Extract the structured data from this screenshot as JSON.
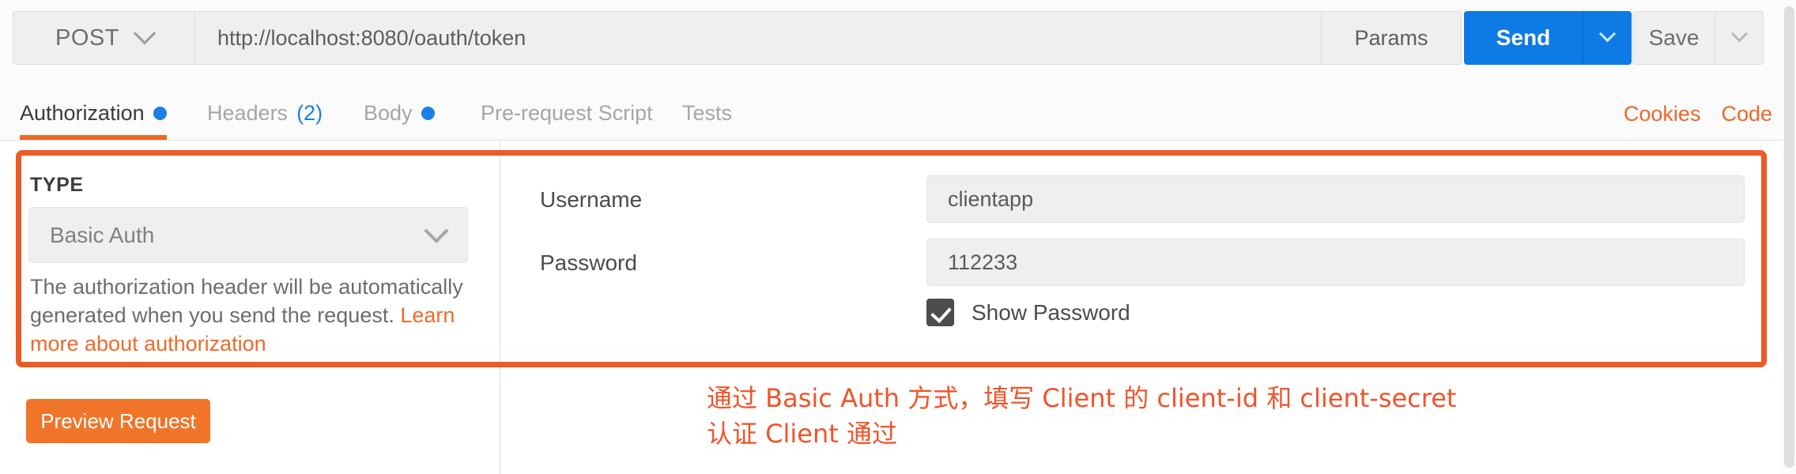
{
  "request_bar": {
    "method": "POST",
    "url": "http://localhost:8080/oauth/token",
    "params_label": "Params",
    "send_label": "Send",
    "save_label": "Save"
  },
  "tabs": [
    {
      "label": "Authorization",
      "indicator": "dot",
      "active": true
    },
    {
      "label": "Headers",
      "count": "(2)",
      "active": false
    },
    {
      "label": "Body",
      "indicator": "dot",
      "active": false
    },
    {
      "label": "Pre-request Script",
      "active": false
    },
    {
      "label": "Tests",
      "active": false
    }
  ],
  "tab_links": [
    {
      "label": "Cookies"
    },
    {
      "label": "Code"
    }
  ],
  "auth_panel": {
    "type_heading": "TYPE",
    "type_selected": "Basic Auth",
    "description_part1": "The authorization header will be automatically generated when you send the request. ",
    "description_link": "Learn more about authorization",
    "preview_button": "Preview Request"
  },
  "form": {
    "username_label": "Username",
    "username_value": "clientapp",
    "password_label": "Password",
    "password_value": "112233",
    "show_password_label": "Show Password"
  },
  "annotation": {
    "text": "通过 Basic Auth 方式，填写 Client 的 client-id 和 client-secret\n认证 Client 通过"
  },
  "colors": {
    "accent_orange": "#ee6723",
    "annotation_orange": "#f0542a",
    "send_blue": "#0d7ae5",
    "dot_blue": "#1a80e6",
    "preview_orange": "#f07528"
  }
}
